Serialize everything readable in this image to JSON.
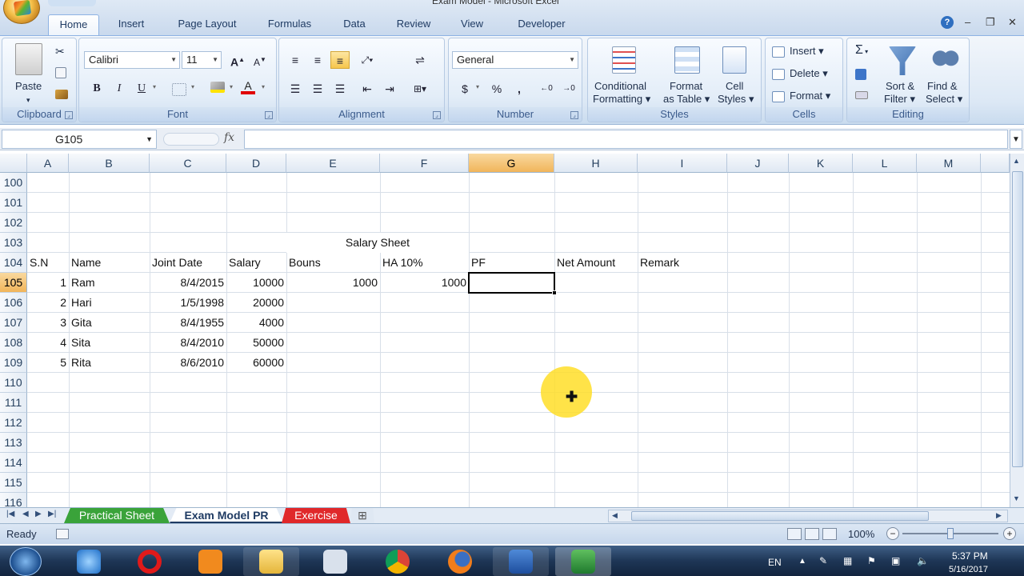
{
  "window": {
    "title": "Exam Model - Microsoft Excel"
  },
  "tabs": [
    "Home",
    "Insert",
    "Page Layout",
    "Formulas",
    "Data",
    "Review",
    "View",
    "Developer"
  ],
  "ribbon": {
    "clipboard": {
      "label": "Clipboard",
      "paste": "Paste"
    },
    "font": {
      "label": "Font",
      "name": "Calibri",
      "size": "11",
      "bold": "B",
      "italic": "I",
      "underline": "U",
      "grow": "A",
      "shrink": "A",
      "color_a": "A"
    },
    "alignment": {
      "label": "Alignment"
    },
    "number": {
      "label": "Number",
      "format": "General",
      "currency": "$",
      "percent": "%",
      "comma": ","
    },
    "styles": {
      "label": "Styles",
      "conditional": "Conditional",
      "conditional2": "Formatting",
      "format_table": "Format",
      "format_table2": "as Table",
      "cell_styles": "Cell",
      "cell_styles2": "Styles"
    },
    "cells": {
      "label": "Cells",
      "insert": "Insert",
      "delete": "Delete",
      "format": "Format"
    },
    "editing": {
      "label": "Editing",
      "sigma": "Σ",
      "sort": "Sort &",
      "sort2": "Filter",
      "find": "Find &",
      "find2": "Select"
    }
  },
  "formula_bar": {
    "name_box": "G105",
    "fx": "fx",
    "value": ""
  },
  "columns": [
    "A",
    "B",
    "C",
    "D",
    "E",
    "F",
    "G",
    "H",
    "I",
    "J",
    "K",
    "L",
    "M"
  ],
  "rows": [
    "100",
    "101",
    "102",
    "103",
    "104",
    "105",
    "106",
    "107",
    "108",
    "109",
    "110",
    "111",
    "112",
    "113",
    "114",
    "115",
    "116"
  ],
  "sheet": {
    "title": "Salary Sheet",
    "headers": {
      "sn": "S.N",
      "name": "Name",
      "date": "Joint Date",
      "salary": "Salary",
      "bonus": "Bouns",
      "ha": "HA 10%",
      "pf": "PF",
      "net": "Net Amount",
      "remark": "Remark"
    },
    "records": [
      {
        "sn": "1",
        "name": "Ram",
        "date": "8/4/2015",
        "salary": "10000",
        "bonus": "1000",
        "ha": "1000"
      },
      {
        "sn": "2",
        "name": "Hari",
        "date": "1/5/1998",
        "salary": "20000",
        "bonus": "",
        "ha": ""
      },
      {
        "sn": "3",
        "name": "Gita",
        "date": "8/4/1955",
        "salary": "4000",
        "bonus": "",
        "ha": ""
      },
      {
        "sn": "4",
        "name": "Sita",
        "date": "8/4/2010",
        "salary": "50000",
        "bonus": "",
        "ha": ""
      },
      {
        "sn": "5",
        "name": "Rita",
        "date": "8/6/2010",
        "salary": "60000",
        "bonus": "",
        "ha": ""
      }
    ]
  },
  "sheet_tabs": [
    {
      "label": "Practical Sheet",
      "color": "#3aa33a"
    },
    {
      "label": "Exam Model PR",
      "color": "#ffffff"
    },
    {
      "label": "Exercise",
      "color": "#e0282a"
    }
  ],
  "status": {
    "mode": "Ready",
    "zoom": "100%"
  },
  "taskbar": {
    "lang": "EN",
    "time": "5:37 PM",
    "date": "5/16/2017"
  }
}
